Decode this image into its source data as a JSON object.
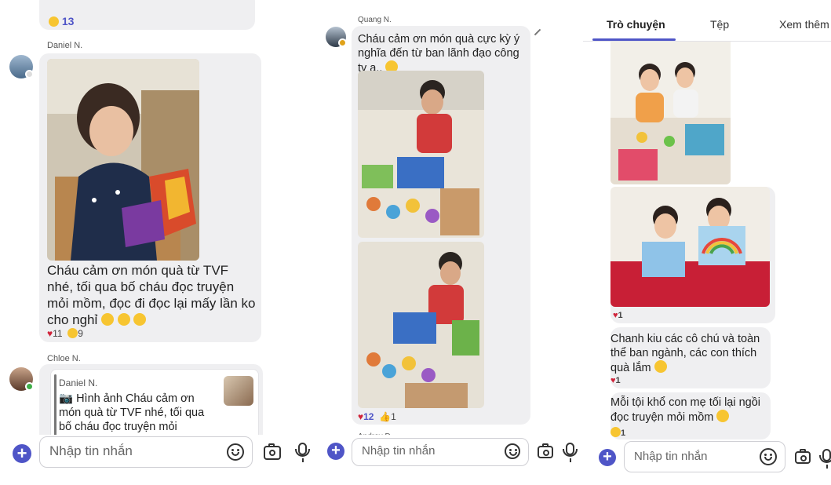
{
  "panel1": {
    "top_reaction": {
      "icon": "sun-emoji",
      "count": "13"
    },
    "msg1": {
      "sender": "Daniel N.",
      "text": "Cháu cảm ơn món quà từ TVF nhé, tối qua bố cháu đọc truyện mỏi mồm, đọc đi đọc lại mấy lần ko cho nghỉ",
      "emojis": "🤣🤣🤣",
      "reactions": [
        {
          "icon": "heart",
          "count": "11"
        },
        {
          "icon": "sun-emoji",
          "count": "9"
        }
      ]
    },
    "msg2": {
      "sender": "Chloe N.",
      "quote_sender": "Daniel N.",
      "quote_text": "📷 Hình ảnh Cháu cảm ơn món quà từ TVF nhé, tối qua bố cháu đọc truyện mỏi mồm,"
    },
    "composer": {
      "placeholder": "Nhập tin nhắn"
    }
  },
  "panel2": {
    "msg1": {
      "sender": "Quang N.",
      "text": "Cháu cảm ơn món quà cực kỳ ý nghĩa đến từ ban lãnh đạo công ty ạ..",
      "reactions": [
        {
          "icon": "heart",
          "count": "12"
        },
        {
          "icon": "thumbs-up",
          "count": "1"
        }
      ]
    },
    "next_sender": "Andrey D.",
    "composer": {
      "placeholder": "Nhập tin nhắn"
    }
  },
  "panel3": {
    "tabs": [
      {
        "label": "Trò chuyện",
        "active": true
      },
      {
        "label": "Tệp"
      },
      {
        "label": "Xem thêm"
      }
    ],
    "photo_reaction": {
      "icon": "heart",
      "count": "1"
    },
    "msg1": {
      "text": "Chanh kiu các cô chú và toàn thể ban ngành, các con thích quà lắm",
      "reaction": {
        "icon": "heart",
        "count": "1"
      }
    },
    "msg2": {
      "text": "Mỗi tội khổ con mẹ tối lại ngồi đọc truyện mỏi mồm",
      "reaction": {
        "icon": "sun-emoji",
        "count": "1"
      }
    },
    "composer": {
      "placeholder": "Nhập tin nhắn"
    }
  },
  "colors": {
    "accent": "#4f55c7",
    "bubble": "#efeff1",
    "heart": "#d0243b",
    "online": "#3fae49",
    "away": "#e0a21a"
  }
}
